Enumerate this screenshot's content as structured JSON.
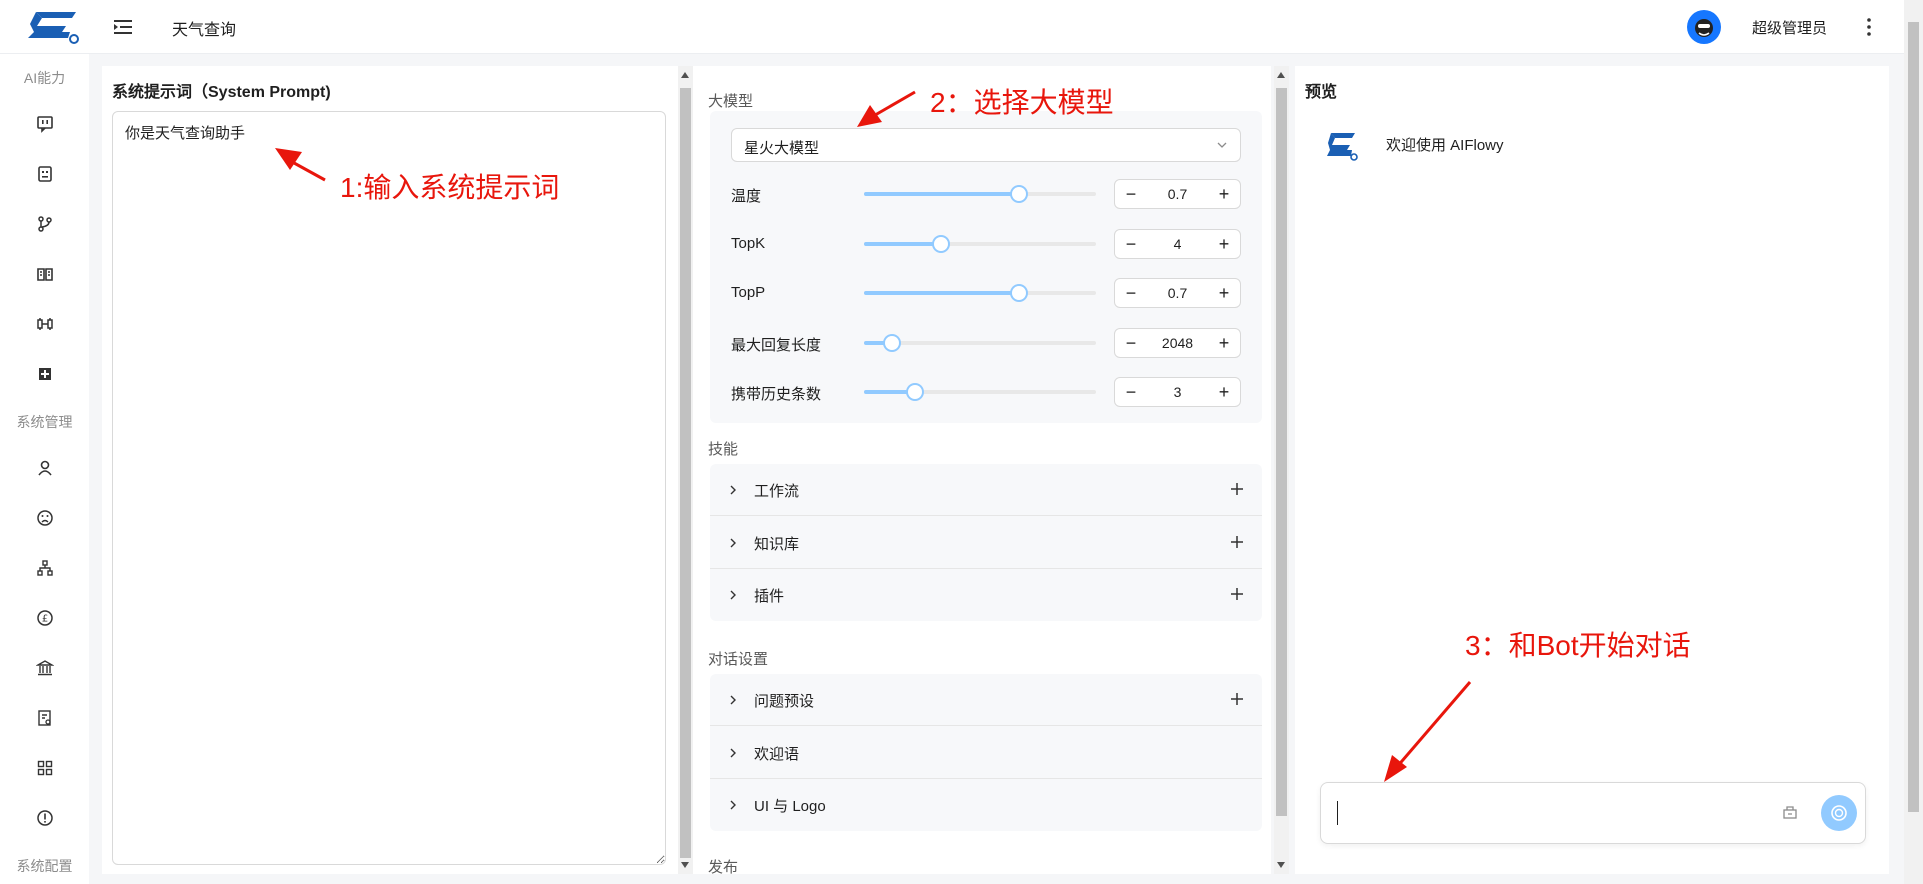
{
  "header": {
    "page_title": "天气查询",
    "user_name": "超级管理员"
  },
  "sidebar": {
    "group_ai": "AI能力",
    "group_system": "系统管理",
    "group_config": "系统配置",
    "ai_items": [
      "tv-icon",
      "robot-icon",
      "branch-icon",
      "book-icon",
      "plug-icon",
      "puzzle-icon"
    ],
    "system_items": [
      "user-icon",
      "sad-face-icon",
      "org-tree-icon",
      "pound-icon",
      "bank-icon",
      "audit-icon",
      "apps-icon",
      "alert-icon"
    ]
  },
  "prompt_panel": {
    "title": "系统提示词（System Prompt)",
    "value": "你是天气查询助手"
  },
  "config_panel": {
    "model_section": "大模型",
    "model_select_value": "星火大模型",
    "params": [
      {
        "label": "温度",
        "value": "0.7",
        "fraction": 0.67
      },
      {
        "label": "TopK",
        "value": "4",
        "fraction": 0.33
      },
      {
        "label": "TopP",
        "value": "0.7",
        "fraction": 0.67
      },
      {
        "label": "最大回复长度",
        "value": "2048",
        "fraction": 0.12
      },
      {
        "label": "携带历史条数",
        "value": "3",
        "fraction": 0.22
      }
    ],
    "skills_section": "技能",
    "skills": [
      {
        "label": "工作流",
        "has_add": true
      },
      {
        "label": "知识库",
        "has_add": true
      },
      {
        "label": "插件",
        "has_add": true
      }
    ],
    "dialog_section": "对话设置",
    "dialog_items": [
      {
        "label": "问题预设",
        "has_add": true
      },
      {
        "label": "欢迎语",
        "has_add": false
      },
      {
        "label": "UI 与 Logo",
        "has_add": false
      }
    ],
    "publish_section": "发布"
  },
  "preview_panel": {
    "title": "预览",
    "welcome_message": "欢迎使用 AIFlowy",
    "chat_input_value": ""
  },
  "annotations": {
    "step1": "1:输入系统提示词",
    "step2": "2：选择大模型",
    "step3": "3：和Bot开始对话"
  },
  "colors": {
    "brand": "#1677ff",
    "slider": "#91caff",
    "annotation": "#e8160c"
  }
}
